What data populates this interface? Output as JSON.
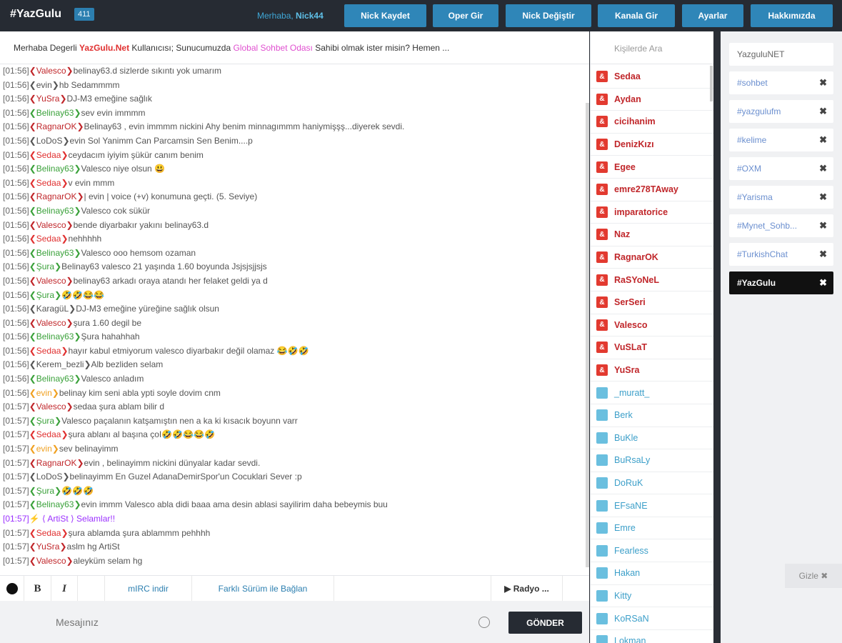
{
  "header": {
    "brand": "#YazGulu",
    "count": "411",
    "greeting_prefix": "Merhaba,",
    "nick": "Nick44",
    "buttons": [
      "Nick Kaydet",
      "Oper Gir",
      "Nick Değiştir",
      "Kanala Gir",
      "Ayarlar",
      "Hakkımızda"
    ]
  },
  "announce": {
    "p1": "Merhaba Degerli ",
    "brand": "YazGulu.Net",
    "p2": " Kullanıcısı; Sunucumuzda ",
    "room": "Global Sohbet Odası",
    "p3": " Sahibi olmak ister misin? Hemen ..."
  },
  "messages": [
    {
      "t": "[01:56]",
      "n": "Valesco",
      "c": "#c0262a",
      "m": "belinay63.d sizlerde sıkıntı yok umarım"
    },
    {
      "t": "[01:56]",
      "n": "evin",
      "c": "#555",
      "m": "hb Sedammmm"
    },
    {
      "t": "[01:56]",
      "n": "YuSra",
      "c": "#c0262a",
      "m": "DJ-M3 emeğine sağlık"
    },
    {
      "t": "[01:56]",
      "n": "Belinay63",
      "c": "#3aa13a",
      "m": "sev evin immmm"
    },
    {
      "t": "[01:56]",
      "n": "RagnarOK",
      "c": "#c0262a",
      "m": "Belinay63 , evin immmm nickini Ahy benim minnagımmm haniymişşş...diyerek sevdi."
    },
    {
      "t": "[01:56]",
      "n": "LoDoS",
      "c": "#555",
      "m": "evin Sol Yanimm Can Parcamsin Sen Benim....p"
    },
    {
      "t": "[01:56]",
      "n": "Sedaa",
      "c": "#e03030",
      "m": "ceydacım iyiyim şükür canım benim"
    },
    {
      "t": "[01:56]",
      "n": "Belinay63",
      "c": "#3aa13a",
      "m": "Valesco niye olsun 😃"
    },
    {
      "t": "[01:56]",
      "n": "Sedaa",
      "c": "#e03030",
      "m": "v evin mmm"
    },
    {
      "t": "[01:56]",
      "n": "RagnarOK",
      "c": "#c0262a",
      "m": "| evin | voice (+v) konumuna geçti. (5. Seviye)"
    },
    {
      "t": "[01:56]",
      "n": "Belinay63",
      "c": "#3aa13a",
      "m": "Valesco cok sükür"
    },
    {
      "t": "[01:56]",
      "n": "Valesco",
      "c": "#c0262a",
      "m": "bende diyarbakır yakını belinay63.d"
    },
    {
      "t": "[01:56]",
      "n": "Sedaa",
      "c": "#e03030",
      "m": "nehhhhh"
    },
    {
      "t": "[01:56]",
      "n": "Belinay63",
      "c": "#3aa13a",
      "m": "Valesco ooo hemsom ozaman"
    },
    {
      "t": "[01:56]",
      "n": "Şura",
      "c": "#3aa13a",
      "m": "Belinay63 valesco 21 yaşında 1.60 boyunda Jsjsjsjjsjs"
    },
    {
      "t": "[01:56]",
      "n": "Valesco",
      "c": "#c0262a",
      "m": "belinay63 arkadı oraya atandı her felaket geldi ya d"
    },
    {
      "t": "[01:56]",
      "n": "Şura",
      "c": "#3aa13a",
      "m": "🤣🤣😂😂"
    },
    {
      "t": "[01:56]",
      "n": "KaragüL",
      "c": "#555",
      "m": "DJ-M3 emeğine yüreğine sağlık olsun"
    },
    {
      "t": "[01:56]",
      "n": "Valesco",
      "c": "#c0262a",
      "m": "şura 1.60 degil be"
    },
    {
      "t": "[01:56]",
      "n": "Belinay63",
      "c": "#3aa13a",
      "m": "Şura hahahhah"
    },
    {
      "t": "[01:56]",
      "n": "Sedaa",
      "c": "#e03030",
      "m": "hayır kabul etmiyorum valesco diyarbakır değil olamaz 😂🤣🤣"
    },
    {
      "t": "[01:56]",
      "n": "Kerem_bezli",
      "c": "#555",
      "m": "Alb bezliden selam"
    },
    {
      "t": "[01:56]",
      "n": "Belinay63",
      "c": "#3aa13a",
      "m": "Valesco anladım"
    },
    {
      "t": "[01:56]",
      "n": "evin",
      "c": "#f0a020",
      "m": "belinay kim seni abla ypti soyle dovim cnm"
    },
    {
      "t": "[01:57]",
      "n": "Valesco",
      "c": "#c0262a",
      "m": "sedaa şura ablam bilir d"
    },
    {
      "t": "[01:57]",
      "n": "Şura",
      "c": "#3aa13a",
      "m": "Valesco paçalanın katşamıştın nen a ka ki kısacık boyunn varr"
    },
    {
      "t": "[01:57]",
      "n": "Sedaa",
      "c": "#e03030",
      "m": "şura ablanı al başına çoI🤣🤣😂😂🤣"
    },
    {
      "t": "[01:57]",
      "n": "evin",
      "c": "#f0a020",
      "m": "sev belinayimm"
    },
    {
      "t": "[01:57]",
      "n": "RagnarOK",
      "c": "#c0262a",
      "m": "evin , belinayimm nickini dünyalar kadar sevdi."
    },
    {
      "t": "[01:57]",
      "n": "LoDoS",
      "c": "#555",
      "m": "belinayimm En Guzel AdanaDemirSpor'un Cocuklari Sever :p"
    },
    {
      "t": "[01:57]",
      "n": "Şura",
      "c": "#3aa13a",
      "m": "🤣🤣🤣"
    },
    {
      "t": "[01:57]",
      "n": "Belinay63",
      "c": "#3aa13a",
      "m": "evin immm Valesco abla didi baaa ama desin ablasi sayilirim daha bebeymis buu"
    },
    {
      "t": "[01:57]",
      "n": "",
      "c": "#9b30ff",
      "m": "⚡ ⟨ ArtiSt ⟩ Selamlar!!",
      "hl": true
    },
    {
      "t": "[01:57]",
      "n": "Sedaa",
      "c": "#e03030",
      "m": "şura ablamda şura ablammm pehhhh"
    },
    {
      "t": "[01:57]",
      "n": "YuSra",
      "c": "#c0262a",
      "m": "aslm hg ArtiSt"
    },
    {
      "t": "[01:57]",
      "n": "Valesco",
      "c": "#c0262a",
      "m": "aleyküm selam hg"
    }
  ],
  "toolbar": {
    "color": "color",
    "bold": "B",
    "italic": "I",
    "mirc": "mIRC indir",
    "alt": "Farklı Sürüm ile Bağlan",
    "radio": "▶  Radyo ..."
  },
  "input": {
    "placeholder": "Mesajınız",
    "send": "GÖNDER"
  },
  "users": {
    "search_placeholder": "Kişilerde Ara",
    "list": [
      {
        "name": "Sedaa",
        "role": "op"
      },
      {
        "name": "Aydan",
        "role": "op"
      },
      {
        "name": "cicihanim",
        "role": "op"
      },
      {
        "name": "DenizKızı",
        "role": "op"
      },
      {
        "name": "Egee",
        "role": "op"
      },
      {
        "name": "emre278TAway",
        "role": "op"
      },
      {
        "name": "imparatorice",
        "role": "op"
      },
      {
        "name": "Naz",
        "role": "op"
      },
      {
        "name": "RagnarOK",
        "role": "op"
      },
      {
        "name": "RaSYoNeL",
        "role": "op"
      },
      {
        "name": "SerSeri",
        "role": "op"
      },
      {
        "name": "Valesco",
        "role": "op"
      },
      {
        "name": "VuSLaT",
        "role": "op"
      },
      {
        "name": "YuSra",
        "role": "op"
      },
      {
        "name": "_muratt_",
        "role": "voice"
      },
      {
        "name": "Berk",
        "role": "voice"
      },
      {
        "name": "BuKle",
        "role": "voice"
      },
      {
        "name": "BuRsaLy",
        "role": "voice"
      },
      {
        "name": "DoRuK",
        "role": "voice"
      },
      {
        "name": "EFsaNE",
        "role": "voice"
      },
      {
        "name": "Emre",
        "role": "voice"
      },
      {
        "name": "Fearless",
        "role": "voice"
      },
      {
        "name": "Hakan",
        "role": "voice"
      },
      {
        "name": "Kitty",
        "role": "voice"
      },
      {
        "name": "KoRSaN",
        "role": "voice"
      },
      {
        "name": "Lokman",
        "role": "voice"
      }
    ]
  },
  "rooms": {
    "home": "YazguluNET",
    "list": [
      "#sohbet",
      "#yazgulufm",
      "#kelime",
      "#OXM",
      "#Yarisma",
      "#Mynet_Sohb...",
      "#TurkishChat"
    ],
    "active": "#YazGulu",
    "hide": "Gizle ✖"
  }
}
